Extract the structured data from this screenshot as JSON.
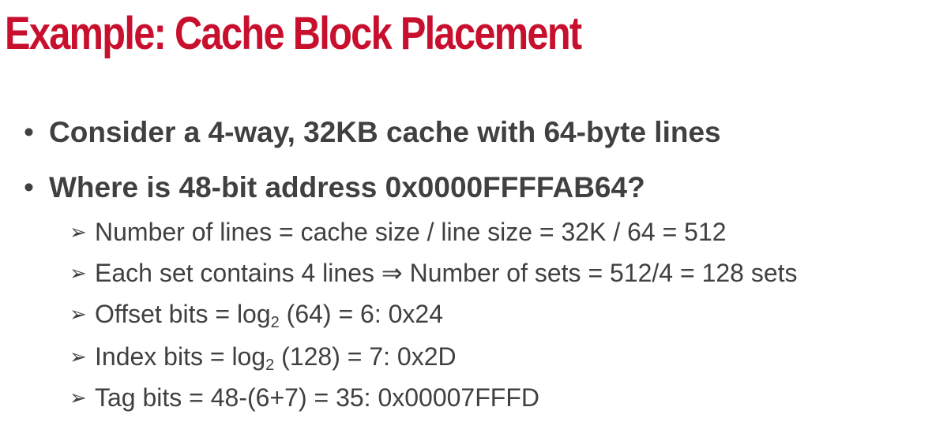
{
  "title": "Example: Cache Block Placement",
  "bullets": [
    "Consider a 4-way, 32KB cache with 64-byte lines",
    "Where is 48-bit address 0x0000FFFFAB64?"
  ],
  "bullet_marker": "•",
  "sub_marker": "➢",
  "sub_items": {
    "lines": "Number of lines = cache size / line size = 32K / 64 = 512",
    "sets": "Each set contains 4 lines ⇒ Number of sets = 512/4 = 128 sets",
    "offset": {
      "prefix": "Offset bits = log",
      "subscript": "2",
      "suffix": " (64) = 6: 0x24"
    },
    "index": {
      "prefix": "Index bits = log",
      "subscript": "2",
      "suffix": " (128) = 7: 0x2D"
    },
    "tag": "Tag bits = 48-(6+7) = 35: 0x00007FFFD"
  },
  "colors": {
    "title": "#c8102e",
    "text": "#404040",
    "background": "#ffffff"
  }
}
